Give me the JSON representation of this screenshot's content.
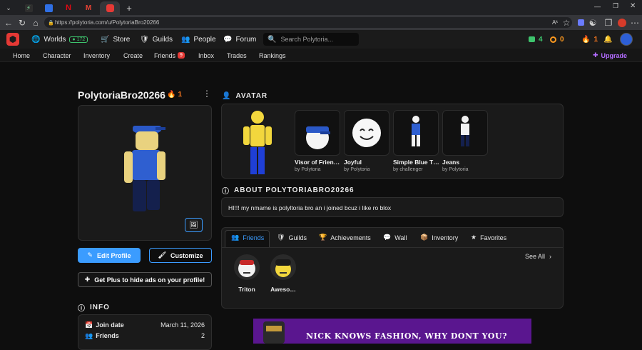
{
  "browser": {
    "tabs": [
      {
        "icon": "lightning-icon"
      },
      {
        "icon": "browser-icon"
      },
      {
        "icon": "netflix-icon",
        "glyph": "N"
      },
      {
        "icon": "gmail-icon",
        "glyph": "M"
      },
      {
        "icon": "polytoria-icon"
      }
    ],
    "new_tab_glyph": "+",
    "url": "https://polytoria.com/u/PolytoriaBro20266"
  },
  "topnav": {
    "worlds_label": "Worlds",
    "online_count": "172",
    "store_label": "Store",
    "guilds_label": "Guilds",
    "people_label": "People",
    "forum_label": "Forum",
    "search_placeholder": "Search Polytoria...",
    "bricks_count": "4",
    "stars_count": "0",
    "streak_count": "1"
  },
  "subnav": {
    "items": [
      "Home",
      "Character",
      "Inventory",
      "Create",
      "Friends",
      "Inbox",
      "Trades",
      "Rankings"
    ],
    "friends_badge": "9",
    "upgrade_label": "Upgrade"
  },
  "profile": {
    "username": "PolytoriaBro20266",
    "streak": "1",
    "edit_label": "Edit Profile",
    "customize_label": "Customize",
    "plus_label": "Get Plus to hide ads on your profile!"
  },
  "info": {
    "title": "INFO",
    "rows": [
      {
        "label": "Join date",
        "value": "March 11, 2026"
      },
      {
        "label": "Friends",
        "value": "2"
      }
    ]
  },
  "avatar": {
    "title": "AVATAR",
    "items": [
      {
        "name": "Visor of Frien…",
        "by": "by Polytoria"
      },
      {
        "name": "Joyful",
        "by": "by Polytoria"
      },
      {
        "name": "Simple Blue T…",
        "by": "by challenger"
      },
      {
        "name": "Jeans",
        "by": "by Polytoria"
      }
    ]
  },
  "about": {
    "title": "ABOUT POLYTORIABRO20266",
    "text": "HI!!! my nmame is polyltoria bro an i joined bcuz i like ro blox"
  },
  "profile_tabs": [
    "Friends",
    "Guilds",
    "Achievements",
    "Wall",
    "Inventory",
    "Favorites"
  ],
  "friends": {
    "see_all": "See All",
    "list": [
      {
        "name": "Triton"
      },
      {
        "name": "Aweso…"
      }
    ]
  },
  "ad": {
    "text": "NICK KNOWS FASHION, WHY DONT YOU?"
  },
  "colors": {
    "accent_blue": "#3b9cff",
    "brand_red": "#e53935",
    "upgrade_purple": "#b36cff",
    "online_green": "#3ec46d"
  }
}
